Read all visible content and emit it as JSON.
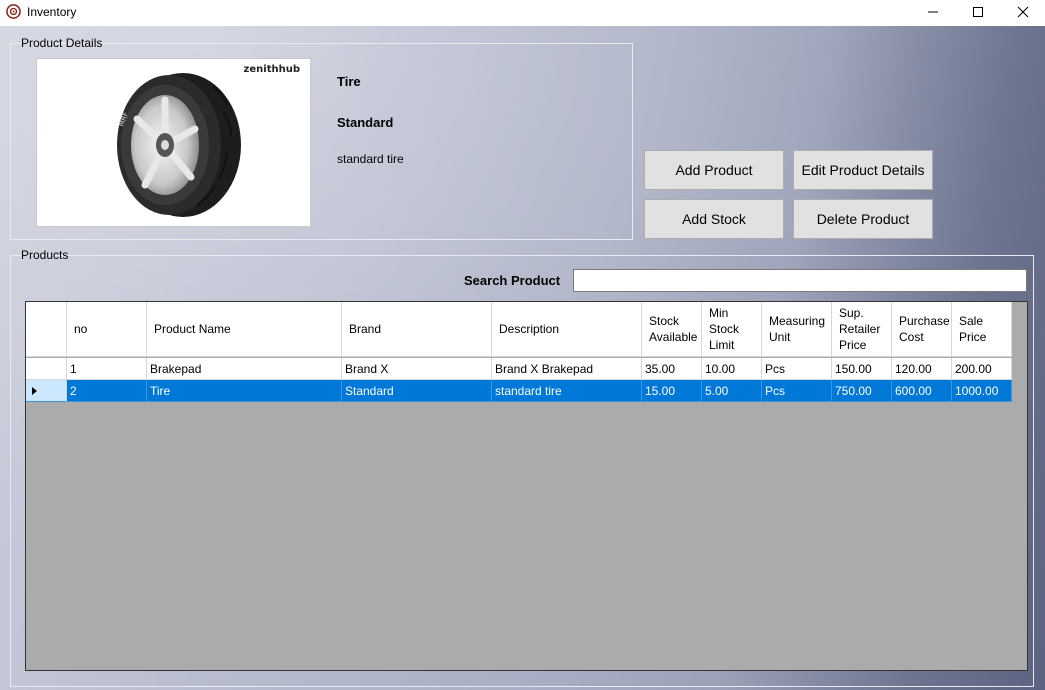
{
  "window": {
    "title": "Inventory",
    "min_glyph": "—",
    "max_glyph": "☐",
    "close_glyph": "✕"
  },
  "product_details": {
    "legend": "Product Details",
    "image_brand": "zenithhub",
    "name": "Tire",
    "brand": "Standard",
    "description": "standard tire"
  },
  "buttons": {
    "add_product": "Add Product",
    "edit_product": "Edit Product Details",
    "add_stock": "Add Stock",
    "delete_product": "Delete Product"
  },
  "products": {
    "legend": "Products",
    "search_label": "Search Product",
    "search_value": "",
    "columns": [
      "",
      "no",
      "Product Name",
      "Brand",
      "Description",
      "Stock Available",
      "Min Stock Limit",
      "Measuring Unit",
      "Sup. Retailer Price",
      "Purchase Cost",
      "Sale Price"
    ],
    "rows": [
      [
        "1",
        "Brakepad",
        "Brand X",
        "Brand X Brakepad",
        "35.00",
        "10.00",
        "Pcs",
        "150.00",
        "120.00",
        "200.00"
      ],
      [
        "2",
        "Tire",
        "Standard",
        "standard tire",
        "15.00",
        "5.00",
        "Pcs",
        "750.00",
        "600.00",
        "1000.00"
      ]
    ],
    "selected_row": 2
  },
  "colors": {
    "selection": "#0078d7",
    "grid_background": "#ababab",
    "button_face": "#e1e1e1"
  }
}
